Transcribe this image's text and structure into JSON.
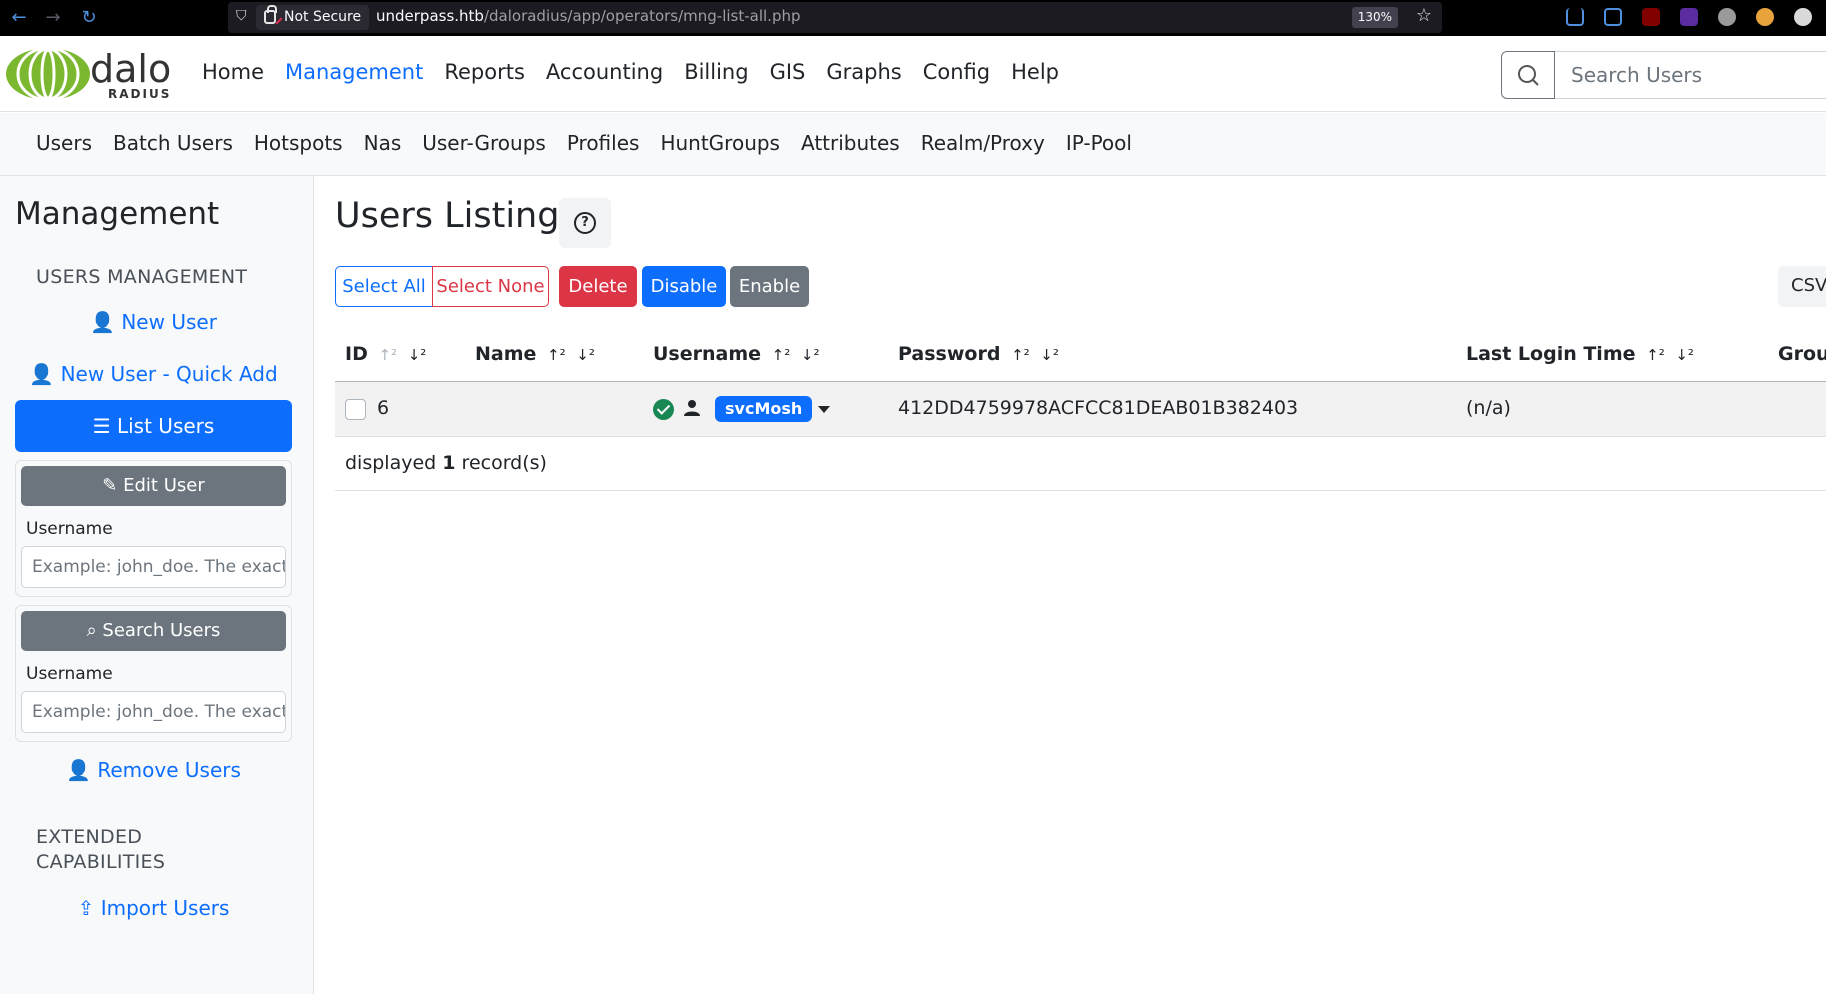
{
  "browser": {
    "security_label": "Not Secure",
    "url_host": "underpass.htb",
    "url_path": "/daloradius/app/operators/mng-list-all.php",
    "zoom": "130%"
  },
  "logo": {
    "text": "dalo",
    "subtext": "RADIUS"
  },
  "main_nav": {
    "items": [
      "Home",
      "Management",
      "Reports",
      "Accounting",
      "Billing",
      "GIS",
      "Graphs",
      "Config",
      "Help"
    ],
    "active": "Management"
  },
  "search": {
    "placeholder": "Search Users"
  },
  "sub_nav": {
    "items": [
      "Users",
      "Batch Users",
      "Hotspots",
      "Nas",
      "User-Groups",
      "Profiles",
      "HuntGroups",
      "Attributes",
      "Realm/Proxy",
      "IP-Pool"
    ]
  },
  "sidebar": {
    "title": "Management",
    "section_users": "USERS MANAGEMENT",
    "new_user": "New User",
    "new_user_quick": "New User - Quick Add",
    "list_users": "List Users",
    "edit_user": "Edit User",
    "edit_label": "Username",
    "edit_placeholder": "Example: john_doe. The exact",
    "search_users": "Search Users",
    "search_label": "Username",
    "search_placeholder": "Example: john_doe. The exact",
    "remove_users": "Remove Users",
    "section_ext_1": "EXTENDED",
    "section_ext_2": "CAPABILITIES",
    "import_users": "Import Users"
  },
  "main": {
    "title": "Users Listing",
    "buttons": {
      "select_all": "Select All",
      "select_none": "Select None",
      "delete": "Delete",
      "disable": "Disable",
      "enable": "Enable",
      "csv": "CSV"
    },
    "columns": {
      "id": "ID",
      "name": "Name",
      "username": "Username",
      "password": "Password",
      "last_login": "Last Login Time",
      "groups": "Grou"
    },
    "rows": [
      {
        "id": "6",
        "name": "",
        "username": "svcMosh",
        "password": "412DD4759978ACFCC81DEAB01B382403",
        "last_login": "(n/a)"
      }
    ],
    "footer_prefix": "displayed",
    "footer_count": "1",
    "footer_suffix": "record(s)"
  },
  "colors": {
    "primary": "#0d6efd",
    "danger": "#dc3545",
    "secondary": "#6c757d",
    "success": "#198754"
  }
}
